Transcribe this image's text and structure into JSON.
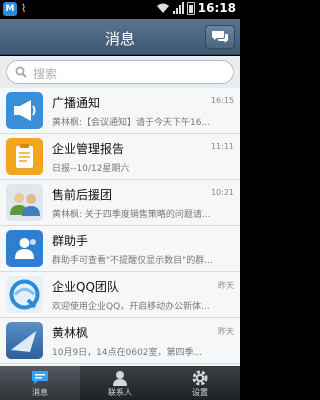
{
  "status_bar": {
    "app_badge": "M",
    "time": "16:18"
  },
  "header": {
    "title": "消息"
  },
  "search": {
    "placeholder": "搜索"
  },
  "conversations": [
    {
      "name": "广播通知",
      "time": "16:15",
      "preview": "黄林枫:【会议通知】请于今天下午16..."
    },
    {
      "name": "企业管理报告",
      "time": "11:11",
      "preview": "日报--10/12星期六"
    },
    {
      "name": "售前后援团",
      "time": "10:21",
      "preview": "黄林枫: 关于四季度销售策略的问题请..."
    },
    {
      "name": "群助手",
      "time": "",
      "preview": "群助手可查看\"不提醒仅显示数目\"的群..."
    },
    {
      "name": "企业QQ团队",
      "time": "昨天",
      "preview": "欢迎使用企业QQ，开启移动办公新体..."
    },
    {
      "name": "黄林枫",
      "time": "昨天",
      "preview": "10月9日，14点在0602室，第四季..."
    }
  ],
  "tabs": [
    {
      "label": "消息",
      "icon": "chat-icon",
      "active": true
    },
    {
      "label": "联系人",
      "icon": "contact-icon",
      "active": false
    },
    {
      "label": "设置",
      "icon": "gear-icon",
      "active": false
    }
  ],
  "colors": {
    "header": "#4b6582",
    "tab_bar": "#2a2e33",
    "accent_blue": "#2e8bd8"
  }
}
